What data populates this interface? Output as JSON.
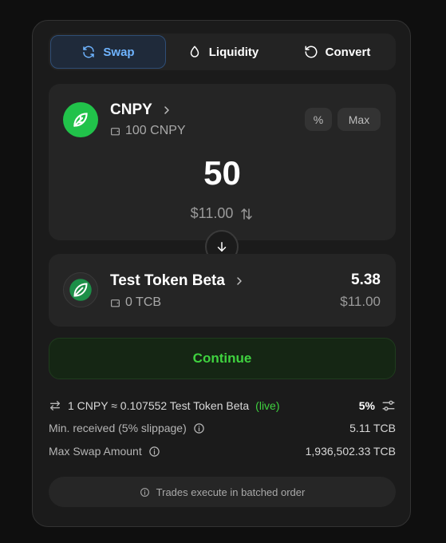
{
  "tabs": [
    {
      "label": "Swap",
      "icon": "refresh-icon",
      "active": true
    },
    {
      "label": "Liquidity",
      "icon": "droplet-icon",
      "active": false
    },
    {
      "label": "Convert",
      "icon": "rotate-ccw-icon",
      "active": false
    }
  ],
  "from_token": {
    "symbol": "CNPY",
    "balance": "100 CNPY",
    "percent_button": "%",
    "max_button": "Max",
    "amount": "50",
    "usd_value": "$11.00"
  },
  "to_token": {
    "name": "Test Token Beta",
    "balance": "0 TCB",
    "amount": "5.38",
    "usd_value": "$11.00"
  },
  "continue_label": "Continue",
  "details": {
    "rate": "1 CNPY ≈ 0.107552 Test Token Beta",
    "rate_status": "(live)",
    "slippage": "5%",
    "min_received_label": "Min. received (5% slippage)",
    "min_received_value": "5.11 TCB",
    "max_swap_label": "Max Swap Amount",
    "max_swap_value": "1,936,502.33 TCB"
  },
  "footer_note": "Trades execute in batched order",
  "colors": {
    "accent_green": "#3fd23f",
    "brand_green": "#21c24a",
    "active_tab_blue": "#6fb4ff",
    "card_bg": "#1b1b1b"
  }
}
